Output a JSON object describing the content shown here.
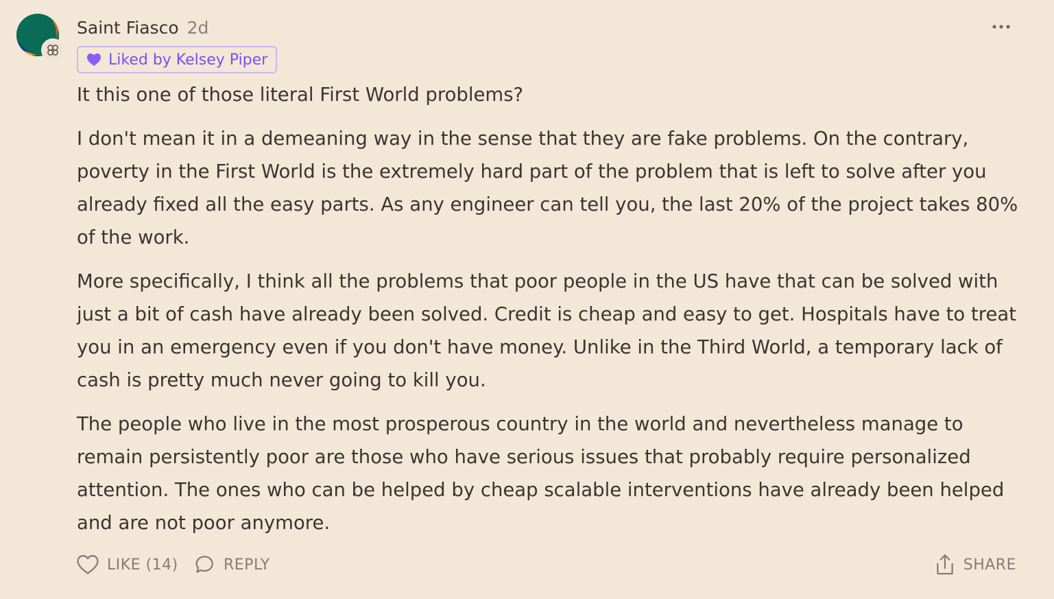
{
  "comment": {
    "author": "Saint Fiasco",
    "time_ago": "2d",
    "liked_by": "Liked by Kelsey Piper",
    "paragraphs": [
      "It this one of those literal First World problems?",
      "I don't mean it in a demeaning way in the sense that they are fake problems. On the contrary, poverty in the First World is the extremely hard part of the problem that is left to solve after you already fixed all the easy parts. As any engineer can tell you, the last 20% of the project takes 80% of the work.",
      "More specifically, I think all the problems that poor people in the US have that can be solved with just a bit of cash have already been solved. Credit is cheap and easy to get. Hospitals have to treat you in an emergency even if you don't have money. Unlike in the Third World, a temporary lack of cash is pretty much never going to kill you.",
      "The people who live in the most prosperous country in the world and nevertheless manage to remain persistently poor are those who have serious issues that probably require personalized attention. The ones who can be helped by cheap scalable interventions have already been helped and are not poor anymore."
    ]
  },
  "actions": {
    "like_label": "LIKE (14)",
    "reply_label": "REPLY",
    "share_label": "SHARE"
  },
  "icons": {
    "avatar": "avatar-image",
    "badge": "subscriber-badge-icon",
    "more": "more-options-icon",
    "heart_filled": "heart-filled-icon",
    "like": "heart-outline-icon",
    "reply": "speech-bubble-icon",
    "share": "share-upload-icon"
  },
  "colors": {
    "background": "#f3e7d7",
    "text": "#3b3530",
    "muted": "#857d74",
    "accent_purple": "#7c4ff0",
    "badge_border": "#c9b8f2"
  }
}
